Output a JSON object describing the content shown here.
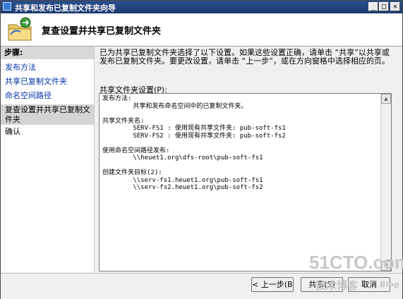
{
  "window": {
    "title": "共享和发布已复制文件夹向导",
    "controls": {
      "minimize": "_",
      "maximize": "□",
      "close": "✕"
    }
  },
  "header": {
    "title": "复查设置并共享已复制文件夹",
    "icon": "shared-folder-wizard-icon"
  },
  "steps": {
    "heading": "步骤:",
    "items": [
      {
        "label": "发布方法"
      },
      {
        "label": "共享已复制文件夹"
      },
      {
        "label": "命名空间路径"
      },
      {
        "label": "复查设置并共享已复制文件夹"
      },
      {
        "label": "确认"
      }
    ]
  },
  "main": {
    "description": "已为共享已复制文件夹选择了以下设置。如果这些设置正确，请单击 “共享”以共享或发布已复制文件夹。要更改设置，请单击 “上一步”，或在方向窗格中选择相应的页。",
    "list_label": "共享文件夹设置(P):",
    "settings_text": "发布方法:\n        共享和发布命名空间中的已复制文件夹。\n\n共享文件夹名:\n        SERV-FS1 : 使用现有共享文件夹: pub-soft-fs1\n        SERV-FS2 : 使用现有共享文件夹: pub-soft-fs2\n\n使用命名空间路径发布:\n        \\\\heuet1.org\\dfs-root\\pub-soft-fs1\n\n创建文件夹目标(2):\n        \\\\serv-fs1.heuet1.org\\pub-soft-fs1\n        \\\\serv-fs2.heuet1.org\\pub-soft-fs2"
  },
  "footer": {
    "back_label": "< 上一步(B)",
    "share_label": "共享(S)",
    "cancel_label": "取消"
  },
  "watermark": {
    "site": "51CTO.com",
    "tagline": "技术博客",
    "blog": "Blog"
  }
}
